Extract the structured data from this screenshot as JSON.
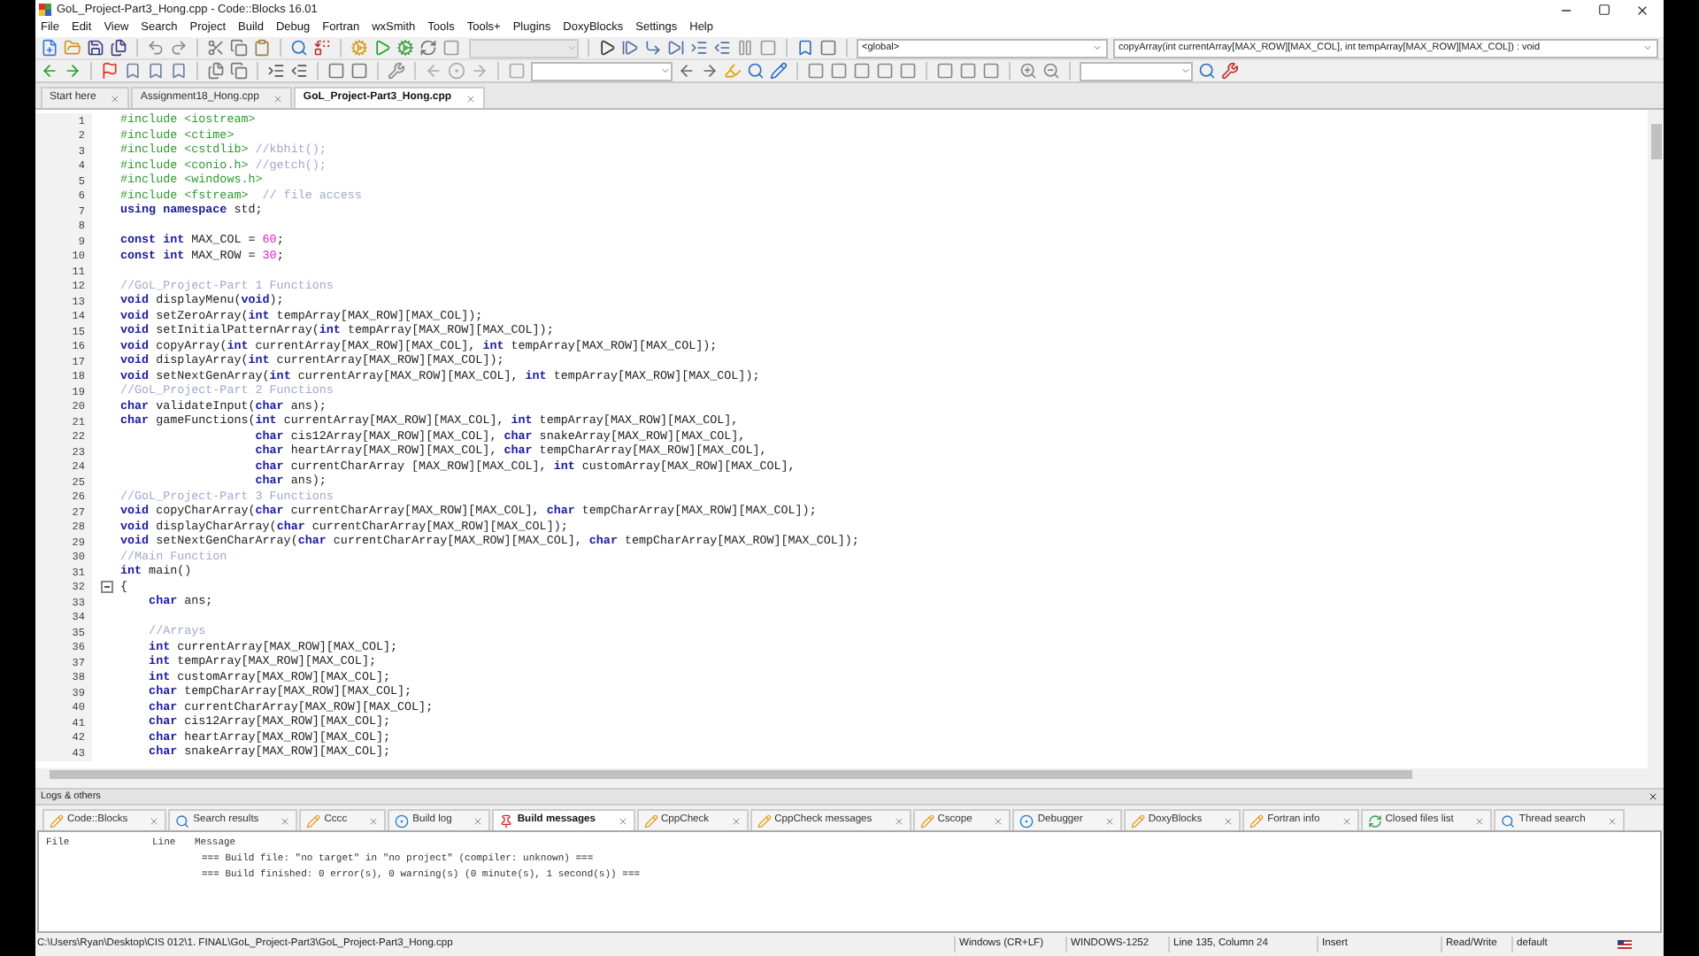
{
  "window": {
    "title": "GoL_Project-Part3_Hong.cpp - Code::Blocks 16.01"
  },
  "menu": [
    "File",
    "Edit",
    "View",
    "Search",
    "Project",
    "Build",
    "Debug",
    "Fortran",
    "wxSmith",
    "Tools",
    "Tools+",
    "Plugins",
    "DoxyBlocks",
    "Settings",
    "Help"
  ],
  "toolbar": {
    "scope_combo": "<global>",
    "function_combo": "copyArray(int currentArray[MAX_ROW][MAX_COL], int tempArray[MAX_ROW][MAX_COL]) : void"
  },
  "editor_tabs": [
    {
      "label": "Start here",
      "selected": false
    },
    {
      "label": "Assignment18_Hong.cpp",
      "selected": false
    },
    {
      "label": "GoL_Project-Part3_Hong.cpp",
      "selected": true
    }
  ],
  "code_lines": [
    {
      "n": "1",
      "segments": [
        {
          "kind": "pp",
          "text": "#include <iostream>"
        }
      ]
    },
    {
      "n": "2",
      "segments": [
        {
          "kind": "pp",
          "text": "#include <ctime>"
        }
      ]
    },
    {
      "n": "3",
      "segments": [
        {
          "kind": "pp",
          "text": "#include <cstdlib> "
        },
        {
          "kind": "cm",
          "text": "//kbhit();"
        }
      ]
    },
    {
      "n": "4",
      "segments": [
        {
          "kind": "pp",
          "text": "#include <conio.h> "
        },
        {
          "kind": "cm",
          "text": "//getch();"
        }
      ]
    },
    {
      "n": "5",
      "segments": [
        {
          "kind": "pp",
          "text": "#include <windows.h>"
        }
      ]
    },
    {
      "n": "6",
      "segments": [
        {
          "kind": "pp",
          "text": "#include <fstream>  "
        },
        {
          "kind": "cm",
          "text": "// file access"
        }
      ]
    },
    {
      "n": "7",
      "segments": [
        {
          "kind": "kw",
          "text": "using namespace"
        },
        {
          "kind": "tx",
          "text": " std;"
        }
      ]
    },
    {
      "n": "8"
    },
    {
      "n": "9",
      "segments": [
        {
          "kind": "kw",
          "text": "const int"
        },
        {
          "kind": "tx",
          "text": " MAX_COL = "
        },
        {
          "kind": "num",
          "text": "60"
        },
        {
          "kind": "tx",
          "text": ";"
        }
      ]
    },
    {
      "n": "10",
      "segments": [
        {
          "kind": "kw",
          "text": "const int"
        },
        {
          "kind": "tx",
          "text": " MAX_ROW = "
        },
        {
          "kind": "num",
          "text": "30"
        },
        {
          "kind": "tx",
          "text": ";"
        }
      ]
    },
    {
      "n": "11"
    },
    {
      "n": "12",
      "segments": [
        {
          "kind": "cm",
          "text": "//GoL_Project-Part 1 Functions"
        }
      ]
    },
    {
      "n": "13",
      "segments": [
        {
          "kind": "kw",
          "text": "void"
        },
        {
          "kind": "tx",
          "text": " displayMenu("
        },
        {
          "kind": "kw",
          "text": "void"
        },
        {
          "kind": "tx",
          "text": ");"
        }
      ]
    },
    {
      "n": "14",
      "segments": [
        {
          "kind": "kw",
          "text": "void"
        },
        {
          "kind": "tx",
          "text": " setZeroArray("
        },
        {
          "kind": "kw",
          "text": "int"
        },
        {
          "kind": "tx",
          "text": " tempArray[MAX_ROW][MAX_COL]);"
        }
      ]
    },
    {
      "n": "15",
      "segments": [
        {
          "kind": "kw",
          "text": "void"
        },
        {
          "kind": "tx",
          "text": " setInitialPatternArray("
        },
        {
          "kind": "kw",
          "text": "int"
        },
        {
          "kind": "tx",
          "text": " tempArray[MAX_ROW][MAX_COL]);"
        }
      ]
    },
    {
      "n": "16",
      "segments": [
        {
          "kind": "kw",
          "text": "void"
        },
        {
          "kind": "tx",
          "text": " copyArray("
        },
        {
          "kind": "kw",
          "text": "int"
        },
        {
          "kind": "tx",
          "text": " currentArray[MAX_ROW][MAX_COL], "
        },
        {
          "kind": "kw",
          "text": "int"
        },
        {
          "kind": "tx",
          "text": " tempArray[MAX_ROW][MAX_COL]);"
        }
      ]
    },
    {
      "n": "17",
      "segments": [
        {
          "kind": "kw",
          "text": "void"
        },
        {
          "kind": "tx",
          "text": " displayArray("
        },
        {
          "kind": "kw",
          "text": "int"
        },
        {
          "kind": "tx",
          "text": " currentArray[MAX_ROW][MAX_COL]);"
        }
      ]
    },
    {
      "n": "18",
      "segments": [
        {
          "kind": "kw",
          "text": "void"
        },
        {
          "kind": "tx",
          "text": " setNextGenArray("
        },
        {
          "kind": "kw",
          "text": "int"
        },
        {
          "kind": "tx",
          "text": " currentArray[MAX_ROW][MAX_COL], "
        },
        {
          "kind": "kw",
          "text": "int"
        },
        {
          "kind": "tx",
          "text": " tempArray[MAX_ROW][MAX_COL]);"
        }
      ]
    },
    {
      "n": "19",
      "segments": [
        {
          "kind": "cm",
          "text": "//GoL_Project-Part 2 Functions"
        }
      ]
    },
    {
      "n": "20",
      "segments": [
        {
          "kind": "kw",
          "text": "char"
        },
        {
          "kind": "tx",
          "text": " validateInput("
        },
        {
          "kind": "kw",
          "text": "char"
        },
        {
          "kind": "tx",
          "text": " ans);"
        }
      ]
    },
    {
      "n": "21",
      "segments": [
        {
          "kind": "kw",
          "text": "char"
        },
        {
          "kind": "tx",
          "text": " gameFunctions("
        },
        {
          "kind": "kw",
          "text": "int"
        },
        {
          "kind": "tx",
          "text": " currentArray[MAX_ROW][MAX_COL], "
        },
        {
          "kind": "kw",
          "text": "int"
        },
        {
          "kind": "tx",
          "text": " tempArray[MAX_ROW][MAX_COL],"
        }
      ]
    },
    {
      "n": "22",
      "segments": [
        {
          "kind": "kw",
          "text": "                   char"
        },
        {
          "kind": "tx",
          "text": " cis12Array[MAX_ROW][MAX_COL], "
        },
        {
          "kind": "kw",
          "text": "char"
        },
        {
          "kind": "tx",
          "text": " snakeArray[MAX_ROW][MAX_COL],"
        }
      ]
    },
    {
      "n": "23",
      "segments": [
        {
          "kind": "kw",
          "text": "                   char"
        },
        {
          "kind": "tx",
          "text": " heartArray[MAX_ROW][MAX_COL], "
        },
        {
          "kind": "kw",
          "text": "char"
        },
        {
          "kind": "tx",
          "text": " tempCharArray[MAX_ROW][MAX_COL],"
        }
      ]
    },
    {
      "n": "24",
      "segments": [
        {
          "kind": "kw",
          "text": "                   char"
        },
        {
          "kind": "tx",
          "text": " currentCharArray [MAX_ROW][MAX_COL], "
        },
        {
          "kind": "kw",
          "text": "int"
        },
        {
          "kind": "tx",
          "text": " customArray[MAX_ROW][MAX_COL],"
        }
      ]
    },
    {
      "n": "25",
      "segments": [
        {
          "kind": "kw",
          "text": "                   char"
        },
        {
          "kind": "tx",
          "text": " ans);"
        }
      ]
    },
    {
      "n": "26",
      "segments": [
        {
          "kind": "cm",
          "text": "//GoL_Project-Part 3 Functions"
        }
      ]
    },
    {
      "n": "27",
      "segments": [
        {
          "kind": "kw",
          "text": "void"
        },
        {
          "kind": "tx",
          "text": " copyCharArray("
        },
        {
          "kind": "kw",
          "text": "char"
        },
        {
          "kind": "tx",
          "text": " currentCharArray[MAX_ROW][MAX_COL], "
        },
        {
          "kind": "kw",
          "text": "char"
        },
        {
          "kind": "tx",
          "text": " tempCharArray[MAX_ROW][MAX_COL]);"
        }
      ]
    },
    {
      "n": "28",
      "segments": [
        {
          "kind": "kw",
          "text": "void"
        },
        {
          "kind": "tx",
          "text": " displayCharArray("
        },
        {
          "kind": "kw",
          "text": "char"
        },
        {
          "kind": "tx",
          "text": " currentCharArray[MAX_ROW][MAX_COL]);"
        }
      ]
    },
    {
      "n": "29",
      "segments": [
        {
          "kind": "kw",
          "text": "void"
        },
        {
          "kind": "tx",
          "text": " setNextGenCharArray("
        },
        {
          "kind": "kw",
          "text": "char"
        },
        {
          "kind": "tx",
          "text": " currentCharArray[MAX_ROW][MAX_COL], "
        },
        {
          "kind": "kw",
          "text": "char"
        },
        {
          "kind": "tx",
          "text": " tempCharArray[MAX_ROW][MAX_COL]);"
        }
      ]
    },
    {
      "n": "30",
      "segments": [
        {
          "kind": "cm",
          "text": "//Main Function"
        }
      ]
    },
    {
      "n": "31",
      "segments": [
        {
          "kind": "kw",
          "text": "int"
        },
        {
          "kind": "tx",
          "text": " main()"
        }
      ]
    },
    {
      "n": "32",
      "fold": true,
      "segments": [
        {
          "kind": "tx",
          "text": "{"
        }
      ]
    },
    {
      "n": "33",
      "segments": [
        {
          "kind": "kw",
          "text": "    char"
        },
        {
          "kind": "tx",
          "text": " ans;"
        }
      ]
    },
    {
      "n": "34"
    },
    {
      "n": "35",
      "segments": [
        {
          "kind": "cm",
          "text": "    //Arrays"
        }
      ]
    },
    {
      "n": "36",
      "segments": [
        {
          "kind": "kw",
          "text": "    int"
        },
        {
          "kind": "tx",
          "text": " currentArray[MAX_ROW][MAX_COL];"
        }
      ]
    },
    {
      "n": "37",
      "segments": [
        {
          "kind": "kw",
          "text": "    int"
        },
        {
          "kind": "tx",
          "text": " tempArray[MAX_ROW][MAX_COL];"
        }
      ]
    },
    {
      "n": "38",
      "segments": [
        {
          "kind": "kw",
          "text": "    int"
        },
        {
          "kind": "tx",
          "text": " customArray[MAX_ROW][MAX_COL];"
        }
      ]
    },
    {
      "n": "39",
      "segments": [
        {
          "kind": "kw",
          "text": "    char"
        },
        {
          "kind": "tx",
          "text": " tempCharArray[MAX_ROW][MAX_COL];"
        }
      ]
    },
    {
      "n": "40",
      "segments": [
        {
          "kind": "kw",
          "text": "    char"
        },
        {
          "kind": "tx",
          "text": " currentCharArray[MAX_ROW][MAX_COL];"
        }
      ]
    },
    {
      "n": "41",
      "segments": [
        {
          "kind": "kw",
          "text": "    char"
        },
        {
          "kind": "tx",
          "text": " cis12Array[MAX_ROW][MAX_COL];"
        }
      ]
    },
    {
      "n": "42",
      "segments": [
        {
          "kind": "kw",
          "text": "    char"
        },
        {
          "kind": "tx",
          "text": " heartArray[MAX_ROW][MAX_COL];"
        }
      ]
    },
    {
      "n": "43",
      "segments": [
        {
          "kind": "kw",
          "text": "    char"
        },
        {
          "kind": "tx",
          "text": " snakeArray[MAX_ROW][MAX_COL];"
        }
      ]
    }
  ],
  "logs_panel": {
    "title": "Logs & others",
    "tabs": [
      {
        "label": "Code::Blocks",
        "kind": "note",
        "selected": false
      },
      {
        "label": "Search results",
        "kind": "search",
        "selected": false
      },
      {
        "label": "Cccc",
        "kind": "note",
        "selected": false
      },
      {
        "label": "Build log",
        "kind": "log",
        "selected": false
      },
      {
        "label": "Build messages",
        "kind": "pin",
        "selected": true
      },
      {
        "label": "CppCheck",
        "kind": "note",
        "selected": false
      },
      {
        "label": "CppCheck messages",
        "kind": "note",
        "selected": false
      },
      {
        "label": "Cscope",
        "kind": "note",
        "selected": false
      },
      {
        "label": "Debugger",
        "kind": "log",
        "selected": false
      },
      {
        "label": "DoxyBlocks",
        "kind": "note",
        "selected": false
      },
      {
        "label": "Fortran info",
        "kind": "note",
        "selected": false
      },
      {
        "label": "Closed files list",
        "kind": "list",
        "selected": false
      },
      {
        "label": "Thread search",
        "kind": "search",
        "selected": false
      }
    ],
    "columns": [
      "File",
      "Line",
      "Message"
    ],
    "messages": [
      "=== Build file: \"no target\" in \"no project\" (compiler: unknown) ===",
      "=== Build finished: 0 error(s), 0 warning(s) (0 minute(s), 1 second(s)) ==="
    ]
  },
  "status_bar": {
    "path": "C:\\Users\\Ryan\\Desktop\\CIS 012\\1. FINAL\\GoL_Project-Part3\\GoL_Project-Part3_Hong.cpp",
    "line_endings": "Windows (CR+LF)",
    "encoding": "WINDOWS-1252",
    "position": "Line 135, Column 24",
    "mode": "Insert",
    "access": "Read/Write",
    "profile": "default"
  }
}
